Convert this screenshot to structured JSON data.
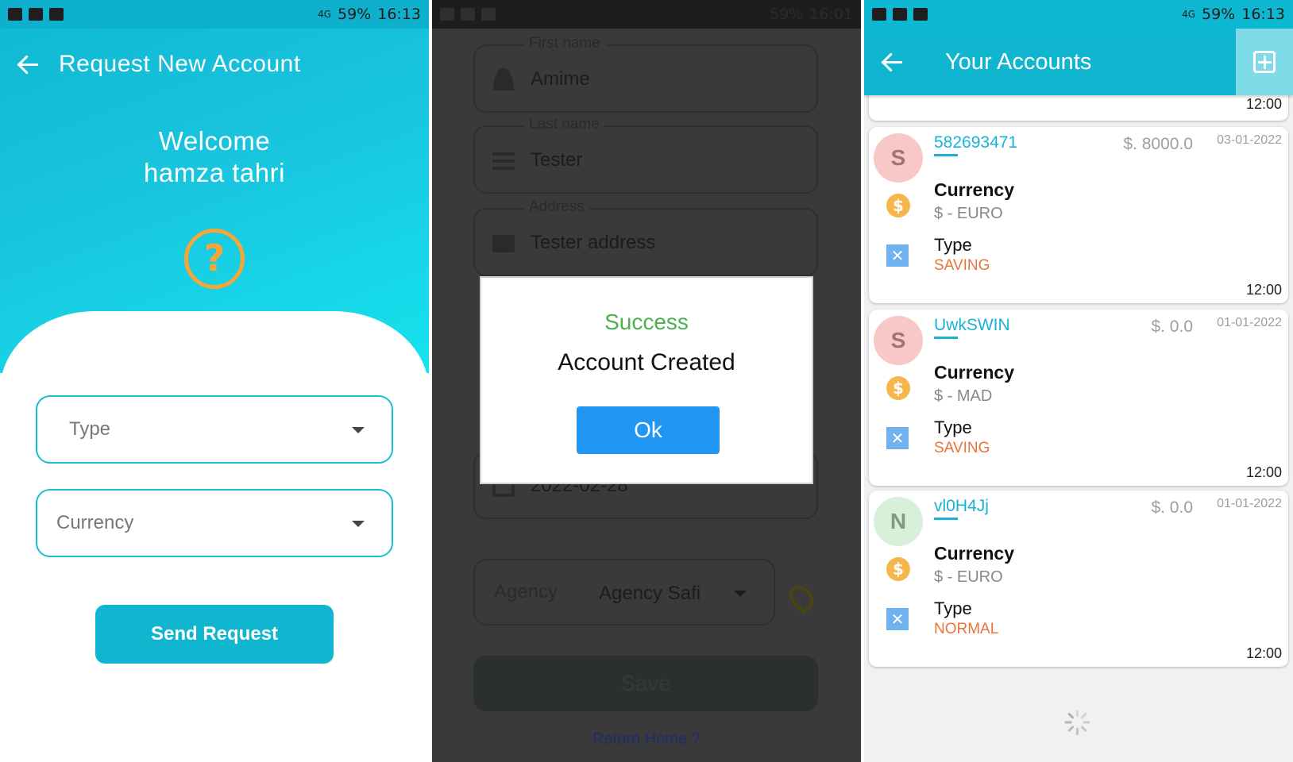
{
  "status_bar": {
    "screen1": {
      "battery": "59%",
      "time": "16:13",
      "network": "4G"
    },
    "screen2": {
      "battery": "59%",
      "time": "16:01"
    },
    "screen3": {
      "battery": "59%",
      "time": "16:13",
      "network": "4G"
    }
  },
  "request_screen": {
    "title": "Request New Account",
    "welcome_line1": "Welcome",
    "welcome_line2": "hamza tahri",
    "help_icon": "?",
    "type_placeholder": "Type",
    "currency_placeholder": "Currency",
    "send_label": "Send Request",
    "colors": {
      "accent": "#10b6d0",
      "help": "#f4a638"
    }
  },
  "form_screen": {
    "first_name": {
      "label": "First name",
      "value": "Amime"
    },
    "last_name": {
      "label": "Last name",
      "value": "Tester"
    },
    "address": {
      "label": "Address",
      "value": "Tester address"
    },
    "date": {
      "value": "2022-02-28"
    },
    "agency": {
      "label": "Agency",
      "value": "Agency Safi"
    },
    "save_label": "Save",
    "return_link": "Return Home ?",
    "dialog": {
      "title": "Success",
      "message": "Account Created",
      "ok_label": "Ok"
    },
    "colors": {
      "success": "#4caf50",
      "ok_button": "#2196f3"
    }
  },
  "accounts_screen": {
    "title": "Your Accounts",
    "partial_time": "12:00",
    "accounts": [
      {
        "avatar": "S",
        "avatar_bg": "#f8c8c6",
        "avatar_fg": "#9c7473",
        "id": "582693471",
        "balance": "$. 8000.0",
        "date": "03-01-2022",
        "currency_label": "Currency",
        "currency": "$ - EURO",
        "type_label": "Type",
        "type": "SAVING",
        "time": "12:00"
      },
      {
        "avatar": "S",
        "avatar_bg": "#f8c8c6",
        "avatar_fg": "#9c7473",
        "id": "UwkSWIN",
        "balance": "$. 0.0",
        "date": "01-01-2022",
        "currency_label": "Currency",
        "currency": "$ - MAD",
        "type_label": "Type",
        "type": "SAVING",
        "time": "12:00"
      },
      {
        "avatar": "N",
        "avatar_bg": "#d8efd9",
        "avatar_fg": "#7c9c7e",
        "id": "vl0H4Jj",
        "balance": "$. 0.0",
        "date": "01-01-2022",
        "currency_label": "Currency",
        "currency": "$ - EURO",
        "type_label": "Type",
        "type": "NORMAL",
        "time": "12:00"
      }
    ],
    "coin_glyph": "$",
    "type_glyph": "✕"
  }
}
